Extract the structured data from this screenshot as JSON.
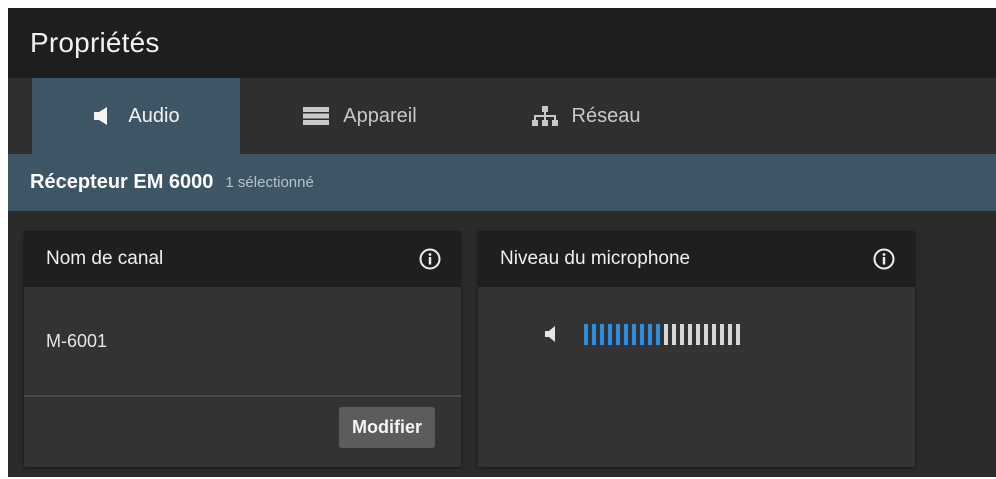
{
  "window": {
    "title": "Propriétés"
  },
  "tabs": [
    {
      "label": "Audio",
      "icon": "speaker-icon",
      "active": true
    },
    {
      "label": "Appareil",
      "icon": "device-icon",
      "active": false
    },
    {
      "label": "Réseau",
      "icon": "network-icon",
      "active": false
    }
  ],
  "selection": {
    "device": "Récepteur EM 6000",
    "count": "1 sélectionné"
  },
  "cards": {
    "channel_name": {
      "title": "Nom de canal",
      "value": "M-6001",
      "button_label": "Modifier",
      "info_icon": "info-icon"
    },
    "mic_level": {
      "title": "Niveau du microphone",
      "info_icon": "info-icon",
      "meter_icon": "speaker-icon",
      "segments_total": 20,
      "segments_lit": 10,
      "level_fraction": 0.5
    }
  },
  "colors": {
    "accent": "#3e5566",
    "meter_active": "#2a8ee0",
    "meter_inactive": "#d6d6d6",
    "titlebar": "#1e1e1e",
    "background": "#2b2b2b"
  }
}
